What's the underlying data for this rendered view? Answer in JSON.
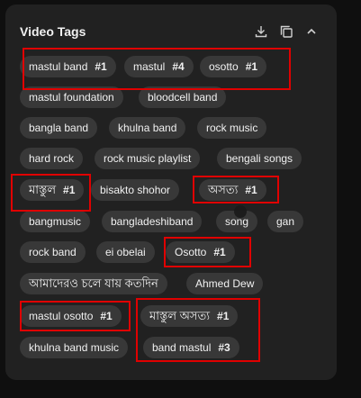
{
  "panel": {
    "title": "Video Tags",
    "actions": [
      {
        "icon": "download-icon"
      },
      {
        "icon": "copy-icon"
      },
      {
        "icon": "chevron-up-icon"
      }
    ]
  },
  "tags": [
    {
      "name": "mastul band",
      "rank": "#1"
    },
    {
      "name": "mastul",
      "rank": "#4"
    },
    {
      "name": "osotto",
      "rank": "#1"
    },
    {
      "name": "mastul foundation",
      "rank": ""
    },
    {
      "name": "bloodcell band",
      "rank": ""
    },
    {
      "name": "bangla band",
      "rank": ""
    },
    {
      "name": "khulna band",
      "rank": ""
    },
    {
      "name": "rock music",
      "rank": ""
    },
    {
      "name": "hard rock",
      "rank": ""
    },
    {
      "name": "rock music playlist",
      "rank": ""
    },
    {
      "name": "bengali songs",
      "rank": ""
    },
    {
      "name": "মাস্তুল",
      "rank": "#1"
    },
    {
      "name": "bisakto shohor",
      "rank": ""
    },
    {
      "name": "অসত্য",
      "rank": "#1"
    },
    {
      "name": "bangmusic",
      "rank": ""
    },
    {
      "name": "bangladeshiband",
      "rank": ""
    },
    {
      "name": "song",
      "rank": ""
    },
    {
      "name": "gan",
      "rank": ""
    },
    {
      "name": "rock band",
      "rank": ""
    },
    {
      "name": "ei obelai",
      "rank": ""
    },
    {
      "name": "Osotto",
      "rank": "#1"
    },
    {
      "name": "আমাদেরও চলে যায় কতদিন",
      "rank": ""
    },
    {
      "name": "Ahmed Dew",
      "rank": ""
    },
    {
      "name": "mastul osotto",
      "rank": "#1"
    },
    {
      "name": "মাস্তুল অসত্য",
      "rank": "#1"
    },
    {
      "name": "khulna band music",
      "rank": ""
    },
    {
      "name": "band mastul",
      "rank": "#3"
    }
  ]
}
